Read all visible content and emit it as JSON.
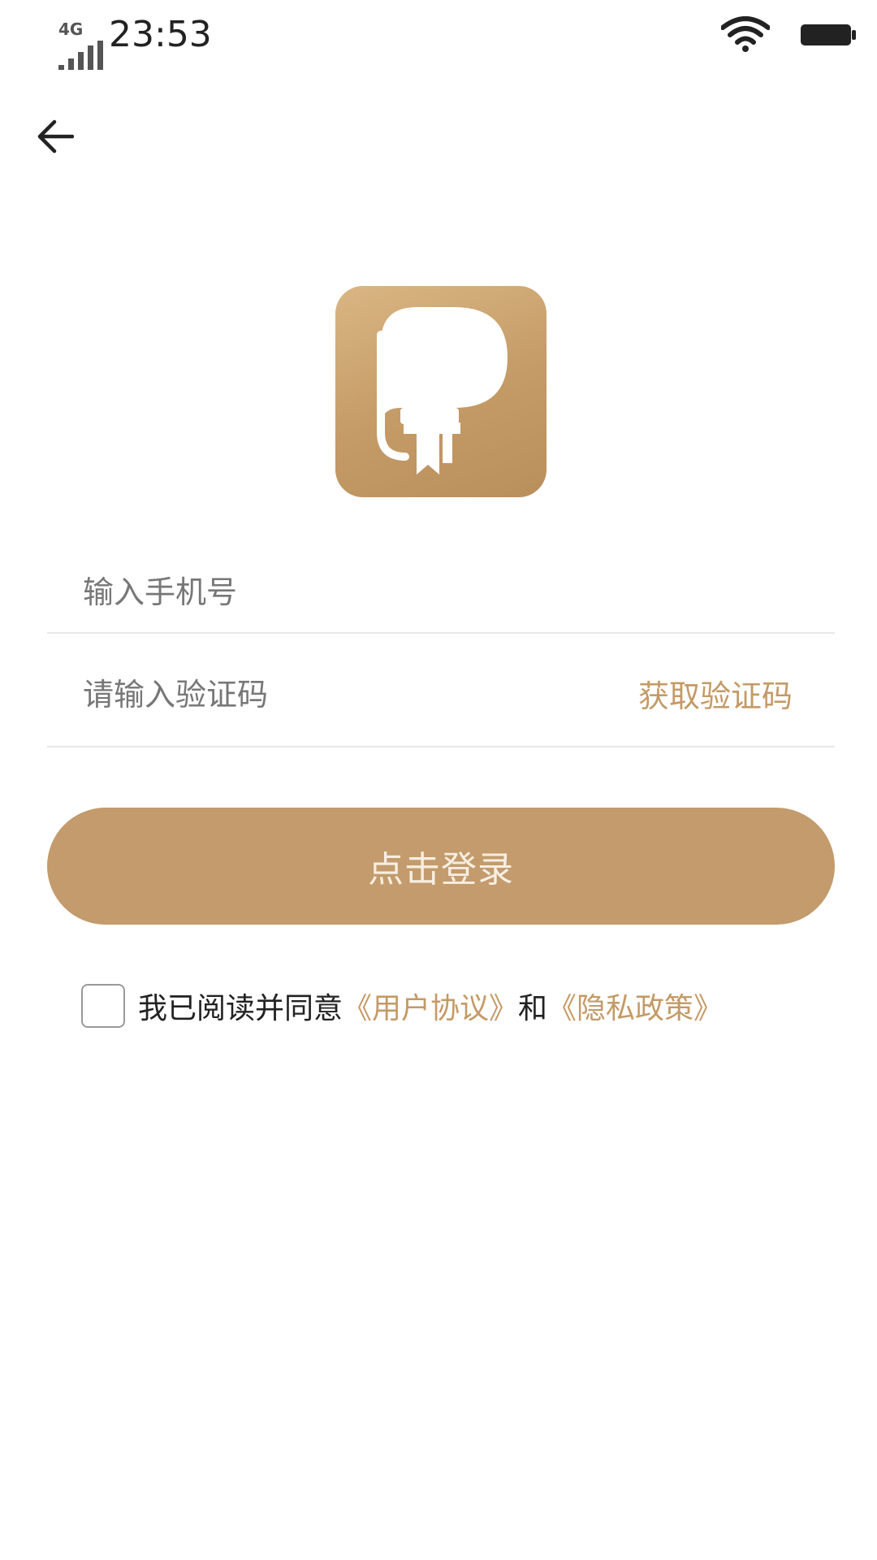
{
  "status_bar": {
    "network_type": "4G",
    "time": "23:53",
    "icons": [
      "signal-icon",
      "wifi-icon",
      "battery-icon"
    ]
  },
  "nav": {
    "back_icon": "arrow-left-icon"
  },
  "logo": {
    "icon": "book-bookmark-logo",
    "color": "#c49a66"
  },
  "form": {
    "phone_placeholder": "输入手机号",
    "phone_value": "",
    "code_placeholder": "请输入验证码",
    "code_value": "",
    "get_code_label": "获取验证码"
  },
  "login_button": {
    "label": "点击登录"
  },
  "agreement": {
    "checked": false,
    "prefix": "我已阅读并同意",
    "user_agreement": "《用户协议》",
    "conjunction": "和",
    "privacy_policy": "《隐私政策》"
  },
  "colors": {
    "accent": "#c49a66",
    "button": "#c39b6c",
    "divider": "#e8e8e8"
  }
}
